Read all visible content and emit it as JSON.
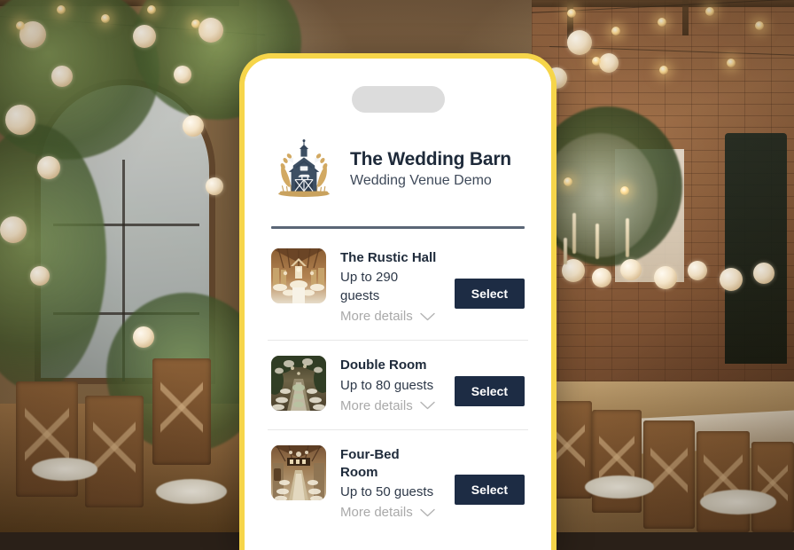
{
  "background": {
    "scene_description": "Blurred wedding venue photo with floral archway, string lights, brick walls and long banquet table with wooden chairs",
    "left_scene": "floral-archway-glass-door",
    "right_scene": "banquet-table-brick-wall"
  },
  "phone": {
    "frame_color": "#f6d54a",
    "notch_label": ""
  },
  "venue": {
    "title": "The Wedding Barn",
    "subtitle": "Wedding Venue Demo",
    "logo_icon": "barn-wheat-crest-logo"
  },
  "theme": {
    "accent_yellow": "#f6d54a",
    "navy": "#1d2c44",
    "heading": "#1e2a3a",
    "muted": "#a9a9a9",
    "divider": "#5a6676",
    "row_divider": "#e8e8e8"
  },
  "listings": {
    "more_details_label": "More details",
    "select_label": "Select",
    "chevron_icon": "chevron-down-icon",
    "items": [
      {
        "name": "The Rustic Hall",
        "capacity": "Up to 290 guests",
        "more_details": "More details",
        "select": "Select",
        "thumb_icon": "rustic-hall-thumbnail"
      },
      {
        "name": "Double Room",
        "capacity": "Up to 80 guests",
        "more_details": "More details",
        "select": "Select",
        "thumb_icon": "double-room-thumbnail"
      },
      {
        "name": "Four-Bed Room",
        "capacity": "Up to 50 guests",
        "more_details": "More details",
        "select": "Select",
        "thumb_icon": "four-bed-room-thumbnail"
      }
    ]
  }
}
